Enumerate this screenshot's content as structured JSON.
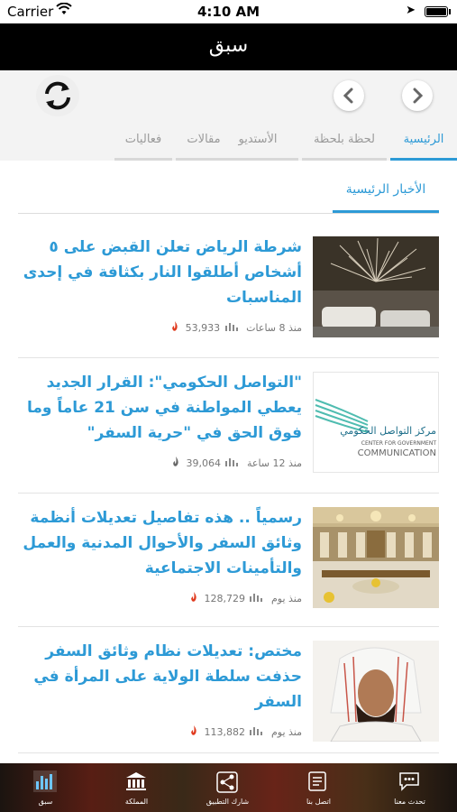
{
  "status_bar": {
    "carrier": "Carrier",
    "time": "4:10 AM"
  },
  "nav": {
    "title": "سبق"
  },
  "tabs": [
    {
      "label": "الرئيسية",
      "active": true
    },
    {
      "label": "لحظة بلحظة",
      "active": false
    },
    {
      "label": "الأستديو",
      "active": false
    },
    {
      "label": "مقالات",
      "active": false
    },
    {
      "label": "فعاليات",
      "active": false
    }
  ],
  "section": {
    "title": "الأخبار الرئيسية"
  },
  "articles": [
    {
      "headline": "شرطة الرياض تعلن القبض على ٥ أشخاص أطلقوا النار بكثافة في إحدى المناسبات",
      "time": "منذ 8 ساعات",
      "views": "53,933",
      "flame": "#e03a1e",
      "thumb": "fireworks"
    },
    {
      "headline": "\"التواصل الحكومي\": القرار الجديد يعطي المواطنة في سن 21 عاماً وما فوق الحق في \"حرية السفر\"",
      "time": "منذ 12 ساعة",
      "views": "39,064",
      "flame": "#666666",
      "thumb": "cgc-logo",
      "logo_ar": "مركز التواصل الحكومي",
      "logo_en1": "CENTER FOR GOVERNMENT",
      "logo_en2": "COMMUNICATION"
    },
    {
      "headline": "رسمياً .. هذه تفاصيل تعديلات أنظمة وثائق السفر والأحوال المدنية والعمل والتأمينات الاجتماعية",
      "time": "منذ يوم",
      "views": "128,729",
      "flame": "#e03a1e",
      "thumb": "council"
    },
    {
      "headline": "مختص: تعديلات نظام وثائق السفر حذفت سلطة الولاية على المرأة في السفر",
      "time": "منذ يوم",
      "views": "113,882",
      "flame": "#e03a1e",
      "thumb": "portrait"
    }
  ],
  "tabbar": [
    {
      "label": "سبق",
      "icon": "bar-chart-icon"
    },
    {
      "label": "المملكة",
      "icon": "bank-icon"
    },
    {
      "label": "شارك التطبيق",
      "icon": "share-icon"
    },
    {
      "label": "اتصل بنا",
      "icon": "contact-icon"
    },
    {
      "label": "تحدث معنا",
      "icon": "chat-icon"
    }
  ],
  "colors": {
    "accent": "#2d9ad6",
    "nav_bg": "#000000",
    "toolbar_bg": "#f3f3f3"
  }
}
